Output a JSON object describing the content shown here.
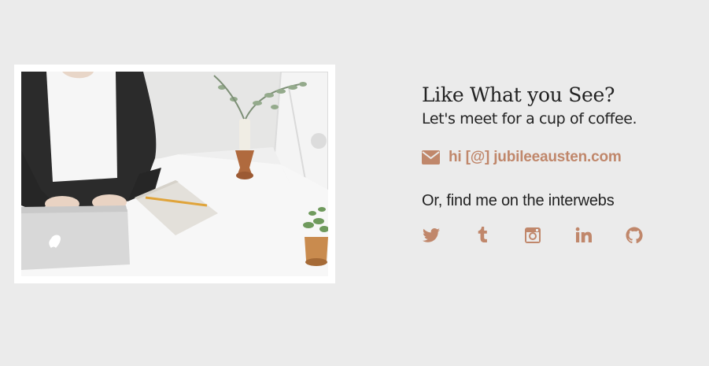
{
  "contact": {
    "headline": "Like What you See?",
    "subhead": "Let's meet for a cup of coffee.",
    "email_icon": "envelope-icon",
    "email_text": "hi [@] jubileeausten.com",
    "social_heading": "Or, find me on the interwebs",
    "social_links": [
      {
        "name": "twitter",
        "icon": "twitter-icon"
      },
      {
        "name": "tumblr",
        "icon": "tumblr-icon"
      },
      {
        "name": "instagram",
        "icon": "instagram-icon"
      },
      {
        "name": "linkedin",
        "icon": "linkedin-icon"
      },
      {
        "name": "github",
        "icon": "github-icon"
      }
    ]
  },
  "colors": {
    "background": "#ebebeb",
    "accent": "#c0876b",
    "text": "#222222"
  }
}
